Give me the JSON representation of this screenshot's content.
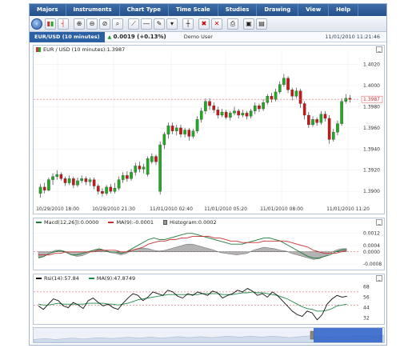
{
  "menu": [
    "Majors",
    "Instruments",
    "Chart Type",
    "Time Scale",
    "Studies",
    "Drawing",
    "View",
    "Help"
  ],
  "toolbar": {
    "buttons": [
      "back-icon",
      "candlestick-icon",
      "ohlc-bar-icon",
      "zoom-in-icon",
      "zoom-out-icon",
      "zoom-reset-icon",
      "zoom-fit-icon",
      "trend-line-icon",
      "horizontal-line-icon",
      "pencil-icon",
      "eraser-icon",
      "crosshair-icon",
      "delete-icon",
      "delete-all-icon",
      "print-icon",
      "save-icon",
      "export-icon"
    ]
  },
  "info": {
    "symbol": "EUR/USD (10 minutes)",
    "price": "0.0019",
    "change": "(+0.13%)",
    "user": "Demo User",
    "datetime": "11/01/2010 11:21:46"
  },
  "price_pane": {
    "label": "EUR / USD (10 minutes):1.3987",
    "current_price": "1.3987",
    "y_ticks": [
      "1.4020",
      "1.4000",
      "1.3980",
      "1.3960",
      "1.3940",
      "1.3920",
      "1.3900"
    ],
    "x_ticks": [
      "10/29/2010 18:00",
      "10/29/2010 21:30",
      "11/01/2010 02:40",
      "11/01/2010 05:20",
      "11/01/2010 08:00",
      "11/01/2010 11:20"
    ],
    "colors": {
      "up": "#22aa22",
      "down": "#c81818",
      "last_line": "#e07070"
    }
  },
  "macd_pane": {
    "macd_label": "Macd(12,26]):0.0000",
    "ma_label": "MA(9):-0.0001",
    "hist_label": "Histogram:0.0002",
    "y_ticks": [
      "0.0012",
      "0.0004",
      "0.0000",
      "-0.0008"
    ],
    "colors": {
      "macd": "#1e7a3a",
      "ma": "#c83030",
      "hist": "#9a9a9a"
    }
  },
  "rsi_pane": {
    "rsi_label": "Rsi(14):57.84",
    "ma_label": "MA(9):47.8749",
    "y_ticks": [
      "68",
      "56",
      "44",
      "32"
    ],
    "colors": {
      "rsi": "#111111",
      "ma": "#1e8a4a",
      "band": "#d04040"
    }
  }
}
